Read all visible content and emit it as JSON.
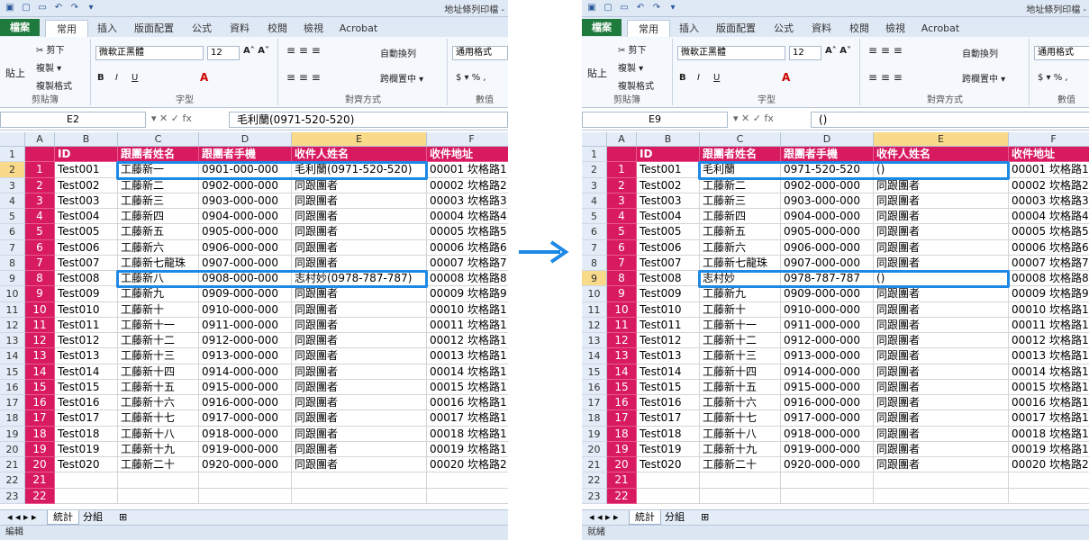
{
  "window_title": "地址條列印檔 -",
  "tabs": [
    "檔案",
    "常用",
    "插入",
    "版面配置",
    "公式",
    "資料",
    "校閱",
    "檢視",
    "Acrobat"
  ],
  "ribbon": {
    "clipboard": {
      "label": "剪貼簿",
      "paste": "貼上",
      "cut": "剪下",
      "copy": "複製 ▾",
      "format_painter": "複製格式"
    },
    "font": {
      "label": "字型",
      "font_name": "微軟正黑體",
      "font_size": "12"
    },
    "alignment": {
      "label": "對齊方式",
      "wrap": "自動換列",
      "merge": "跨欄置中 ▾"
    },
    "number": {
      "label": "數值",
      "format": "通用格式",
      "symbols": "$ ▾ %  ,"
    }
  },
  "columns": [
    "A",
    "B",
    "C",
    "D",
    "E",
    "F"
  ],
  "headers": [
    "ID",
    "跟團者姓名",
    "跟團者手機",
    "收件人姓名",
    "收件地址"
  ],
  "sheets": [
    "統計",
    "分組"
  ],
  "left": {
    "namebox": "E2",
    "formula": "毛利蘭(0971-520-520)",
    "status": "編輯",
    "selected_col": "E",
    "selected_row": 2,
    "rows": [
      [
        "1",
        "Test001",
        "工藤新一",
        "0901-000-000",
        "毛利蘭(0971-520-520)",
        "00001 坎格路1"
      ],
      [
        "2",
        "Test002",
        "工藤新二",
        "0902-000-000",
        "同跟團者",
        "00002 坎格路2"
      ],
      [
        "3",
        "Test003",
        "工藤新三",
        "0903-000-000",
        "同跟團者",
        "00003 坎格路3"
      ],
      [
        "4",
        "Test004",
        "工藤新四",
        "0904-000-000",
        "同跟團者",
        "00004 坎格路4"
      ],
      [
        "5",
        "Test005",
        "工藤新五",
        "0905-000-000",
        "同跟團者",
        "00005 坎格路5"
      ],
      [
        "6",
        "Test006",
        "工藤新六",
        "0906-000-000",
        "同跟團者",
        "00006 坎格路6"
      ],
      [
        "7",
        "Test007",
        "工藤新七龍珠",
        "0907-000-000",
        "同跟團者",
        "00007 坎格路7"
      ],
      [
        "8",
        "Test008",
        "工藤新八",
        "0908-000-000",
        "志村妙(0978-787-787)",
        "00008 坎格路8"
      ],
      [
        "9",
        "Test009",
        "工藤新九",
        "0909-000-000",
        "同跟團者",
        "00009 坎格路9"
      ],
      [
        "10",
        "Test010",
        "工藤新十",
        "0910-000-000",
        "同跟團者",
        "00010 坎格路1"
      ],
      [
        "11",
        "Test011",
        "工藤新十一",
        "0911-000-000",
        "同跟團者",
        "00011 坎格路1"
      ],
      [
        "12",
        "Test012",
        "工藤新十二",
        "0912-000-000",
        "同跟團者",
        "00012 坎格路1"
      ],
      [
        "13",
        "Test013",
        "工藤新十三",
        "0913-000-000",
        "同跟團者",
        "00013 坎格路1"
      ],
      [
        "14",
        "Test014",
        "工藤新十四",
        "0914-000-000",
        "同跟團者",
        "00014 坎格路1"
      ],
      [
        "15",
        "Test015",
        "工藤新十五",
        "0915-000-000",
        "同跟團者",
        "00015 坎格路1"
      ],
      [
        "16",
        "Test016",
        "工藤新十六",
        "0916-000-000",
        "同跟團者",
        "00016 坎格路1"
      ],
      [
        "17",
        "Test017",
        "工藤新十七",
        "0917-000-000",
        "同跟團者",
        "00017 坎格路1"
      ],
      [
        "18",
        "Test018",
        "工藤新十八",
        "0918-000-000",
        "同跟團者",
        "00018 坎格路1"
      ],
      [
        "19",
        "Test019",
        "工藤新十九",
        "0919-000-000",
        "同跟團者",
        "00019 坎格路1"
      ],
      [
        "20",
        "Test020",
        "工藤新二十",
        "0920-000-000",
        "同跟團者",
        "00020 坎格路2"
      ],
      [
        "21",
        "",
        "",
        "",
        "",
        ""
      ],
      [
        "22",
        "",
        "",
        "",
        "",
        ""
      ]
    ],
    "highlight_rows": [
      2,
      9
    ]
  },
  "right": {
    "namebox": "E9",
    "formula": "()",
    "status": "就緒",
    "selected_col": "E",
    "selected_row": 9,
    "rows": [
      [
        "1",
        "Test001",
        "毛利蘭",
        "0971-520-520",
        "()",
        "00001 坎格路1"
      ],
      [
        "2",
        "Test002",
        "工藤新二",
        "0902-000-000",
        "同跟團者",
        "00002 坎格路2"
      ],
      [
        "3",
        "Test003",
        "工藤新三",
        "0903-000-000",
        "同跟團者",
        "00003 坎格路3"
      ],
      [
        "4",
        "Test004",
        "工藤新四",
        "0904-000-000",
        "同跟團者",
        "00004 坎格路4"
      ],
      [
        "5",
        "Test005",
        "工藤新五",
        "0905-000-000",
        "同跟團者",
        "00005 坎格路5"
      ],
      [
        "6",
        "Test006",
        "工藤新六",
        "0906-000-000",
        "同跟團者",
        "00006 坎格路6"
      ],
      [
        "7",
        "Test007",
        "工藤新七龍珠",
        "0907-000-000",
        "同跟團者",
        "00007 坎格路7"
      ],
      [
        "8",
        "Test008",
        "志村妙",
        "0978-787-787",
        "()",
        "00008 坎格路8"
      ],
      [
        "9",
        "Test009",
        "工藤新九",
        "0909-000-000",
        "同跟團者",
        "00009 坎格路9"
      ],
      [
        "10",
        "Test010",
        "工藤新十",
        "0910-000-000",
        "同跟團者",
        "00010 坎格路1"
      ],
      [
        "11",
        "Test011",
        "工藤新十一",
        "0911-000-000",
        "同跟團者",
        "00011 坎格路1"
      ],
      [
        "12",
        "Test012",
        "工藤新十二",
        "0912-000-000",
        "同跟團者",
        "00012 坎格路1"
      ],
      [
        "13",
        "Test013",
        "工藤新十三",
        "0913-000-000",
        "同跟團者",
        "00013 坎格路1"
      ],
      [
        "14",
        "Test014",
        "工藤新十四",
        "0914-000-000",
        "同跟團者",
        "00014 坎格路1"
      ],
      [
        "15",
        "Test015",
        "工藤新十五",
        "0915-000-000",
        "同跟團者",
        "00015 坎格路1"
      ],
      [
        "16",
        "Test016",
        "工藤新十六",
        "0916-000-000",
        "同跟團者",
        "00016 坎格路1"
      ],
      [
        "17",
        "Test017",
        "工藤新十七",
        "0917-000-000",
        "同跟團者",
        "00017 坎格路1"
      ],
      [
        "18",
        "Test018",
        "工藤新十八",
        "0918-000-000",
        "同跟團者",
        "00018 坎格路1"
      ],
      [
        "19",
        "Test019",
        "工藤新十九",
        "0919-000-000",
        "同跟團者",
        "00019 坎格路1"
      ],
      [
        "20",
        "Test020",
        "工藤新二十",
        "0920-000-000",
        "同跟團者",
        "00020 坎格路2"
      ],
      [
        "21",
        "",
        "",
        "",
        "",
        ""
      ],
      [
        "22",
        "",
        "",
        "",
        "",
        ""
      ]
    ],
    "highlight_rows": [
      2,
      9
    ]
  },
  "colors": {
    "pink": "#d81b60",
    "highlight": "#1e88e5",
    "selected_header": "#f9d98a",
    "arrow": "#1e88e5"
  }
}
